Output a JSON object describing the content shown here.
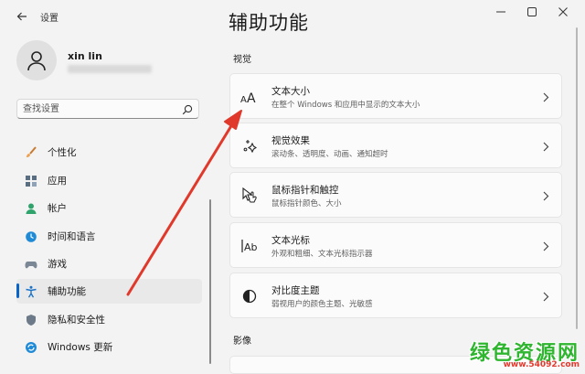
{
  "app": {
    "title": "设置"
  },
  "user": {
    "name": "xin lin"
  },
  "search": {
    "placeholder": "查找设置"
  },
  "nav": {
    "items": [
      {
        "label": "个性化"
      },
      {
        "label": "应用"
      },
      {
        "label": "帐户"
      },
      {
        "label": "时间和语言"
      },
      {
        "label": "游戏"
      },
      {
        "label": "辅助功能"
      },
      {
        "label": "隐私和安全性"
      },
      {
        "label": "Windows 更新"
      }
    ]
  },
  "main": {
    "title": "辅助功能",
    "sections": [
      {
        "label": "视觉"
      },
      {
        "label": "影像"
      }
    ],
    "cards": [
      {
        "title": "文本大小",
        "subtitle": "在整个 Windows 和应用中显示的文本大小"
      },
      {
        "title": "视觉效果",
        "subtitle": "滚动条、透明度、动画、通知超时"
      },
      {
        "title": "鼠标指针和触控",
        "subtitle": "鼠标指针颜色、大小"
      },
      {
        "title": "文本光标",
        "subtitle": "外观和粗细、文本光标指示器"
      },
      {
        "title": "对比度主题",
        "subtitle": "弱视用户的颜色主题、光敏感"
      }
    ]
  },
  "watermark": {
    "text": "绿色资源网",
    "url": "www.54092.com"
  },
  "colors": {
    "accent": "#0a64c8",
    "arrow": "#e0392b",
    "watermark_green": "#2fb52f",
    "watermark_red": "#e23a2e"
  }
}
